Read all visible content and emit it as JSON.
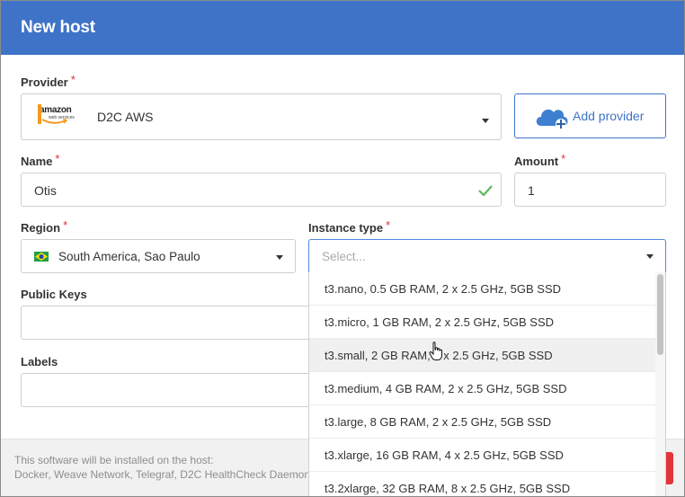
{
  "dialog": {
    "title": "New host"
  },
  "provider": {
    "label": "Provider",
    "required_mark": "*",
    "logo_top": "amazon",
    "logo_bottom": "web services",
    "selected": "D2C AWS",
    "add_label": "Add provider"
  },
  "name": {
    "label": "Name",
    "required_mark": "*",
    "value": "Otis"
  },
  "amount": {
    "label": "Amount",
    "required_mark": "*",
    "value": "1"
  },
  "region": {
    "label": "Region",
    "required_mark": "*",
    "selected": "South America, Sao Paulo"
  },
  "instance_type": {
    "label": "Instance type",
    "required_mark": "*",
    "placeholder": "Select...",
    "options": [
      "t3.nano, 0.5 GB RAM, 2 x 2.5 GHz, 5GB SSD",
      "t3.micro, 1 GB RAM, 2 x 2.5 GHz, 5GB SSD",
      "t3.small, 2 GB RAM, 2 x 2.5 GHz, 5GB SSD",
      "t3.medium, 4 GB RAM, 2 x 2.5 GHz, 5GB SSD",
      "t3.large, 8 GB RAM, 2 x 2.5 GHz, 5GB SSD",
      "t3.xlarge, 16 GB RAM, 4 x 2.5 GHz, 5GB SSD",
      "t3.2xlarge, 32 GB RAM, 8 x 2.5 GHz, 5GB SSD"
    ],
    "hovered_index": 2
  },
  "public_keys": {
    "label": "Public Keys"
  },
  "labels": {
    "label": "Labels"
  },
  "footer": {
    "line1": "This software will be installed on the host:",
    "line2": "Docker, Weave Network, Telegraf, D2C HealthCheck Daemon"
  },
  "colors": {
    "header": "#3f73c8",
    "accent": "#3f73c8",
    "required": "#e0303a",
    "valid_check": "#5cb85c",
    "danger": "#e4343a"
  },
  "icons": {
    "cloud_add": "cloud-plus-icon",
    "check": "check-icon",
    "flag": "brazil-flag-icon",
    "cursor": "hand-pointer-icon"
  }
}
